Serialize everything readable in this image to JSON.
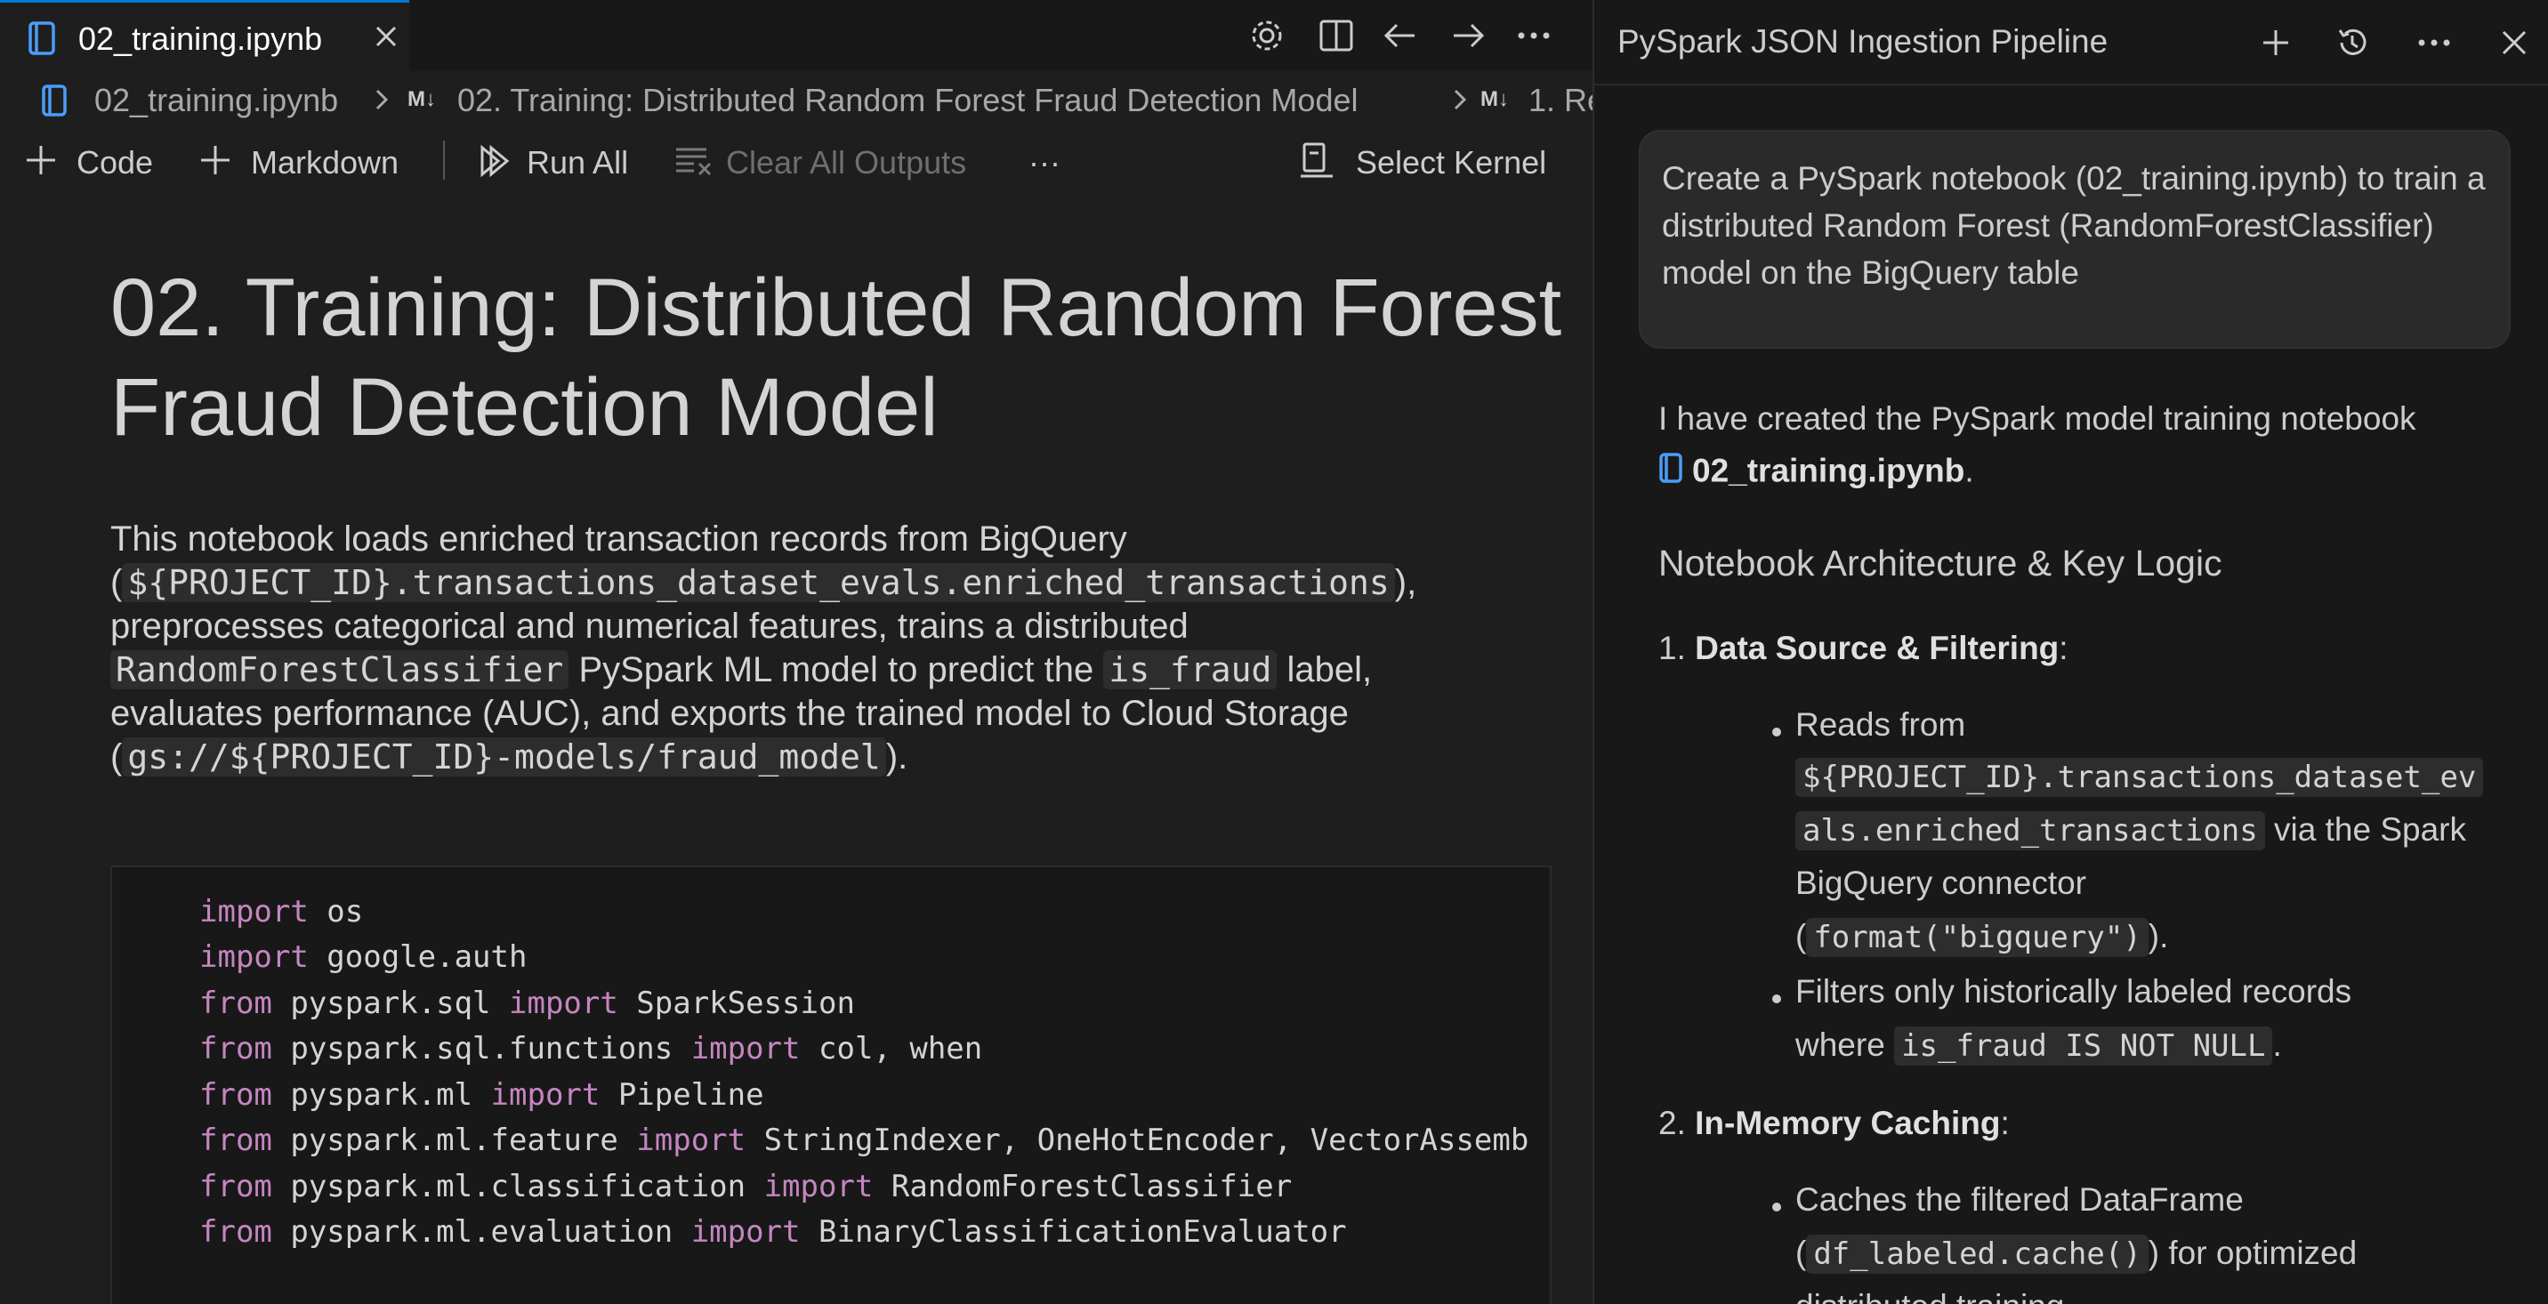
{
  "editor": {
    "tab": {
      "label": "02_training.ipynb"
    },
    "breadcrumb": {
      "file": "02_training.ipynb",
      "section1": "02. Training: Distributed Random Forest Fraud Detection Model",
      "section2": "1. Re"
    },
    "toolbar": {
      "code": "Code",
      "markdown": "Markdown",
      "run_all": "Run All",
      "clear_all": "Clear All Outputs",
      "more": "···",
      "select_kernel": "Select Kernel"
    },
    "markdown": {
      "title_line1": "02. Training: Distributed Random Forest",
      "title_line2": "Fraud Detection Model",
      "desc": {
        "p1": "This notebook loads enriched transaction records from BigQuery",
        "p2_open": "(",
        "p2_code": "${PROJECT_ID}.transactions_dataset_evals.enriched_transactions",
        "p2_close": "),",
        "p3": "preprocesses categorical and numerical features, trains a distributed",
        "p4_code": "RandomForestClassifier",
        "p4_mid": " PySpark ML model to predict the ",
        "p4_code2": "is_fraud",
        "p4_end": " label,",
        "p5": "evaluates performance (AUC), and exports the trained model to Cloud Storage",
        "p6_open": "(",
        "p6_code": "gs://${PROJECT_ID}-models/fraud_model",
        "p6_close": ")."
      }
    },
    "code_lines": [
      {
        "kw1": "import",
        "rest1": " os",
        "kw2": "",
        "rest2": ""
      },
      {
        "kw1": "import",
        "rest1": " google.auth",
        "kw2": "",
        "rest2": ""
      },
      {
        "kw1": "from",
        "rest1": " pyspark.sql ",
        "kw2": "import",
        "rest2": " SparkSession"
      },
      {
        "kw1": "from",
        "rest1": " pyspark.sql.functions ",
        "kw2": "import",
        "rest2": " col, when"
      },
      {
        "kw1": "from",
        "rest1": " pyspark.ml ",
        "kw2": "import",
        "rest2": " Pipeline"
      },
      {
        "kw1": "from",
        "rest1": " pyspark.ml.feature ",
        "kw2": "import",
        "rest2": " StringIndexer, OneHotEncoder, VectorAssemb"
      },
      {
        "kw1": "from",
        "rest1": " pyspark.ml.classification ",
        "kw2": "import",
        "rest2": " RandomForestClassifier"
      },
      {
        "kw1": "from",
        "rest1": " pyspark.ml.evaluation ",
        "kw2": "import",
        "rest2": " BinaryClassificationEvaluator"
      }
    ]
  },
  "chat": {
    "title": "PySpark JSON Ingestion Pipeline",
    "user_message": "Create a PySpark notebook (02_training.ipynb) to train a distributed Random Forest (RandomForestClassifier) model on the BigQuery table",
    "response": {
      "intro": "I have created the PySpark model training notebook",
      "file_ref": "02_training.ipynb",
      "file_ref_end": ".",
      "heading": "Notebook Architecture & Key Logic",
      "item1_num": "1.",
      "item1_title": "Data Source & Filtering",
      "item1_colon": ":",
      "b1_text": "Reads from",
      "b1_code1": "${PROJECT_ID}.transactions_dataset_ev",
      "b1_code2": "als.enriched_transactions",
      "b1_after": " via the Spark",
      "b1_line3": "BigQuery connector",
      "b1_open": "(",
      "b1_code3": "format(\"bigquery\")",
      "b1_close": ").",
      "b2_text": "Filters only historically labeled records",
      "b2_where": "where ",
      "b2_code": "is_fraud IS NOT NULL",
      "b2_end": ".",
      "item2_num": "2.",
      "item2_title": "In-Memory Caching",
      "item2_colon": ":",
      "b3_text": "Caches the filtered DataFrame",
      "b3_open": "(",
      "b3_code": "df_labeled.cache()",
      "b3_after": ") for optimized",
      "b3_line3": "distributed training"
    }
  },
  "colors": {
    "accent": "#0078d4",
    "keyword": "#c586c0",
    "notebook_icon": "#4a9df8"
  }
}
